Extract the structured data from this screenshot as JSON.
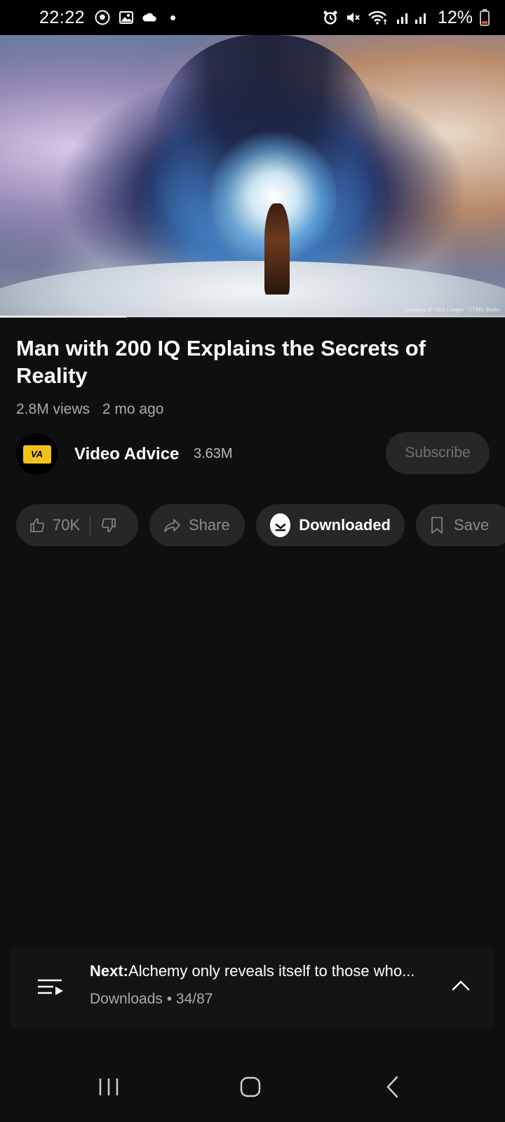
{
  "status_bar": {
    "time": "22:22",
    "battery": "12%"
  },
  "video": {
    "watermark": "Courtesy of Chris Langan · CTMU Radio",
    "progress": 0.25
  },
  "info": {
    "title": "Man with 200 IQ Explains the Secrets of Reality",
    "views": "2.8M views",
    "age": "2 mo ago"
  },
  "channel": {
    "avatar_text": "VA",
    "name": "Video Advice",
    "subscribers": "3.63M",
    "subscribe_label": "Subscribe"
  },
  "actions": {
    "likes": "70K",
    "share": "Share",
    "downloaded": "Downloaded",
    "save": "Save"
  },
  "next": {
    "prefix": "Next:",
    "title": "Alchemy only reveals itself to those who...",
    "playlist": "Downloads • 34/87"
  },
  "icons": {
    "status_left": [
      "soccer-icon",
      "gallery-icon",
      "cloud-icon"
    ],
    "status_right": [
      "alarm-icon",
      "mute-icon",
      "wifi-icon",
      "signal-icon",
      "battery-icon"
    ],
    "nav": [
      "recents-icon",
      "home-icon",
      "back-icon"
    ]
  },
  "colors": {
    "background": "#0f0f0f",
    "pill": "#272727",
    "battery_low": "#e2492f"
  }
}
